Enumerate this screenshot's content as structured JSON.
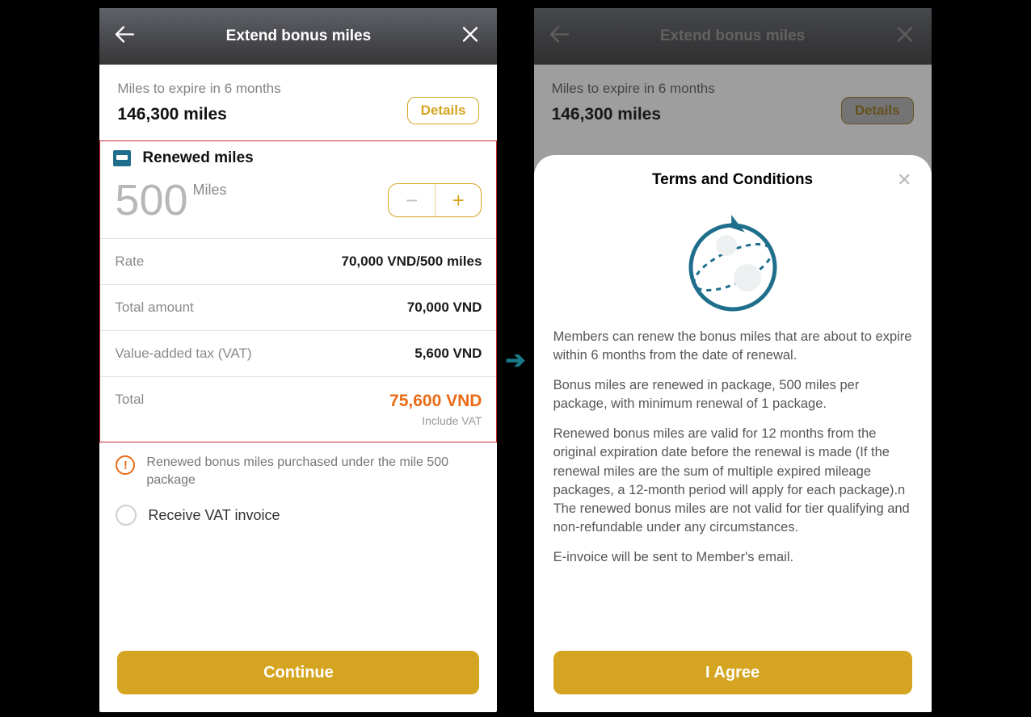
{
  "header": {
    "title": "Extend bonus miles"
  },
  "summary": {
    "subhead": "Miles to expire in 6 months",
    "miles_value": "146,300 miles",
    "details_label": "Details"
  },
  "renewed": {
    "title": "Renewed miles",
    "qty_value": "500",
    "qty_unit": "Miles",
    "rows": {
      "rate": {
        "label": "Rate",
        "value": "70,000 VND/500 miles"
      },
      "amount": {
        "label": "Total amount",
        "value": "70,000 VND"
      },
      "vat": {
        "label": "Value-added tax (VAT)",
        "value": "5,600 VND"
      },
      "total": {
        "label": "Total",
        "value": "75,600 VND",
        "sub": "Include VAT"
      }
    }
  },
  "note": "Renewed bonus miles purchased under the mile 500 package",
  "vat_invoice_label": "Receive VAT invoice",
  "continue_label": "Continue",
  "modal": {
    "title": "Terms and Conditions",
    "p1": "Members can renew the bonus miles that are about to expire within 6 months from the date of renewal.",
    "p2": " Bonus miles are renewed in package, 500 miles per package, with minimum renewal of 1 package.",
    "p3": " Renewed bonus miles are valid for 12 months from the original expiration date before the renewal is made (If the renewal miles are the sum of multiple expired mileage packages, a 12-month period will apply for each package).n",
    "p4": " The renewed bonus miles are not valid for tier qualifying and non-refundable under any circumstances.",
    "p5": " E-invoice will be sent to Member's email.",
    "agree": "I Agree"
  }
}
